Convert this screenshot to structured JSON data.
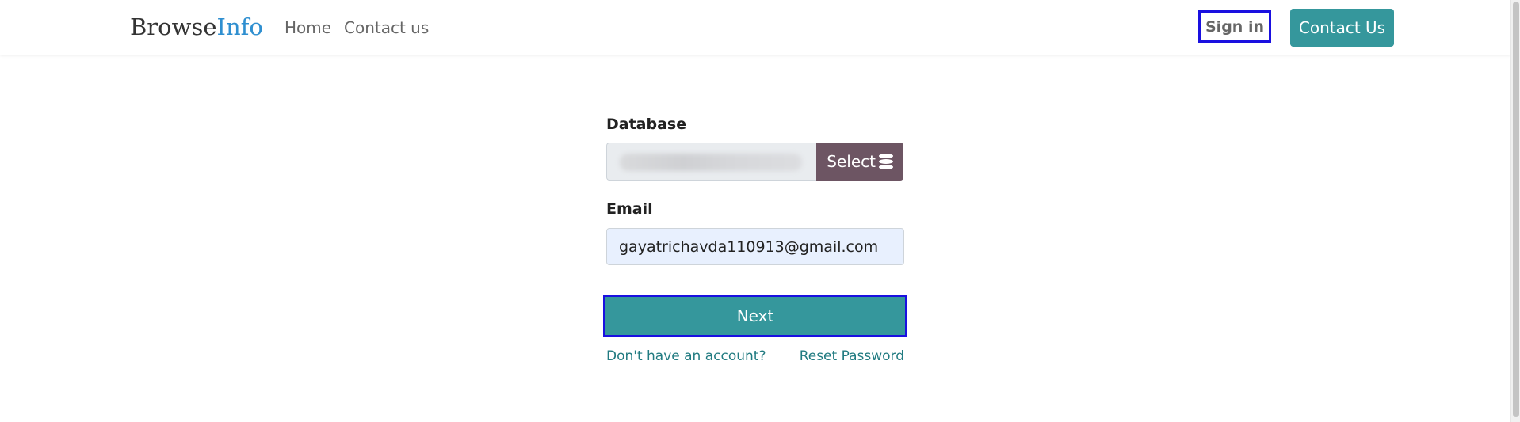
{
  "header": {
    "logo_part1": "Browse",
    "logo_part2": "Info",
    "nav": [
      {
        "label": "Home"
      },
      {
        "label": "Contact us"
      }
    ],
    "signin_label": "Sign in",
    "contact_button_label": "Contact Us"
  },
  "form": {
    "database_label": "Database",
    "database_value": "",
    "select_button_label": "Select",
    "select_icon": "database-icon",
    "email_label": "Email",
    "email_value": "gayatrichavda110913@gmail.com",
    "next_button_label": "Next",
    "signup_link": "Don't have an account?",
    "reset_link": "Reset Password"
  },
  "colors": {
    "accent": "#35979c",
    "select_button": "#6d5563",
    "logo_accent": "#2f8fd0",
    "link": "#217b81",
    "focus_outline": "#1a10e0"
  }
}
